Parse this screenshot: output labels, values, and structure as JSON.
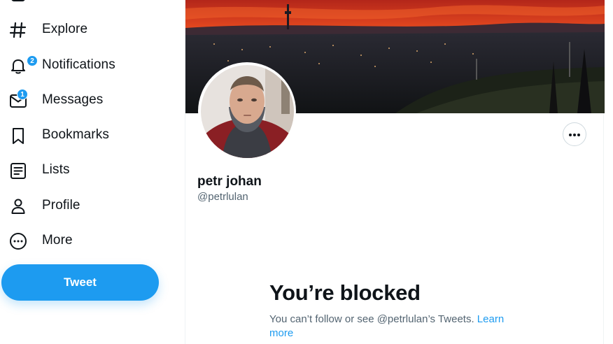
{
  "sidebar": {
    "items": [
      {
        "label": "Explore",
        "icon": "hashtag-icon"
      },
      {
        "label": "Notifications",
        "icon": "bell-icon",
        "badge": "2"
      },
      {
        "label": "Messages",
        "icon": "envelope-icon",
        "badge": "1"
      },
      {
        "label": "Bookmarks",
        "icon": "bookmark-icon"
      },
      {
        "label": "Lists",
        "icon": "list-icon"
      },
      {
        "label": "Profile",
        "icon": "person-icon"
      },
      {
        "label": "More",
        "icon": "more-circle-icon"
      }
    ],
    "tweet_label": "Tweet"
  },
  "profile": {
    "display_name": "petr johan",
    "handle": "@petrlulan"
  },
  "blocked": {
    "title": "You’re blocked",
    "message": "You can’t follow or see @petrlulan’s Tweets.",
    "link": "Learn more"
  },
  "colors": {
    "accent": "#1d9bf0",
    "text": "#0f1419",
    "secondary_text": "#536471",
    "border": "#eff3f4"
  }
}
